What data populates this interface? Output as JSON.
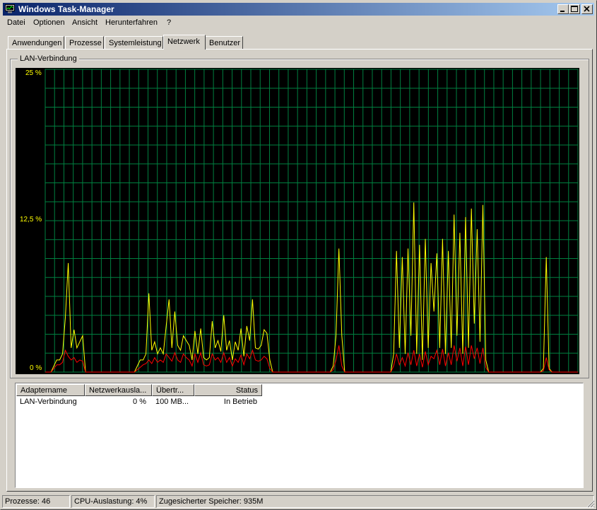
{
  "window": {
    "title": "Windows Task-Manager"
  },
  "menu": [
    "Datei",
    "Optionen",
    "Ansicht",
    "Herunterfahren",
    "?"
  ],
  "tabs": [
    "Anwendungen",
    "Prozesse",
    "Systemleistung",
    "Netzwerk",
    "Benutzer"
  ],
  "active_tab": "Netzwerk",
  "group": {
    "label": "LAN-Verbindung"
  },
  "graph": {
    "y_labels": [
      "25 %",
      "12,5 %",
      "0 %"
    ],
    "colors": {
      "background": "#000000",
      "grid": "#008040",
      "line_total": "#ffff00",
      "line_sent": "#ff0000"
    }
  },
  "chart_data": {
    "type": "line",
    "title": "LAN-Verbindung",
    "ylim": [
      0,
      25
    ],
    "y_tick_labels": [
      "25 %",
      "12,5 %",
      "0 %"
    ],
    "grid": true,
    "series": [
      {
        "color": "#ffff00",
        "values": [
          0,
          0,
          0,
          0.5,
          1,
          1,
          1.5,
          4.5,
          9,
          2,
          3.5,
          2,
          2.5,
          3,
          0,
          0,
          0,
          0,
          0,
          0,
          0,
          0,
          0,
          0,
          0,
          0,
          0,
          0,
          0,
          0,
          0,
          0,
          0.5,
          1,
          1,
          1.5,
          6.5,
          1.8,
          2.5,
          1.5,
          2,
          1.5,
          3.8,
          6,
          2,
          5,
          2.2,
          1.8,
          3,
          2.6,
          2.2,
          1,
          3.4,
          1.5,
          3.6,
          1.2,
          1,
          1.2,
          4.2,
          2,
          2.6,
          1.7,
          4.7,
          1.8,
          2.6,
          1,
          2.5,
          1.8,
          3.6,
          1.3,
          3.8,
          2.6,
          6,
          2,
          1.9,
          2.2,
          3.5,
          3.2,
          1,
          0,
          0,
          0,
          0,
          0,
          0,
          0,
          0,
          0,
          0,
          0,
          0,
          0,
          0,
          0,
          0,
          0,
          0,
          0,
          0,
          0,
          0.5,
          3,
          10.2,
          3,
          0,
          0,
          0,
          0,
          0,
          0,
          0,
          0,
          0,
          0,
          0,
          0,
          0,
          0,
          0,
          0,
          0,
          1.5,
          10,
          2,
          9.5,
          1.5,
          10.2,
          3,
          14,
          1.5,
          10.5,
          1,
          11,
          2,
          9,
          5,
          9.8,
          2,
          11,
          1.5,
          10,
          2,
          13,
          3,
          11.5,
          1.5,
          12.8,
          2,
          13.5,
          4,
          11.8,
          2.5,
          13.8,
          1,
          0,
          0,
          0,
          0,
          0,
          0,
          0,
          0,
          0,
          0,
          0,
          0,
          0,
          0,
          0,
          0,
          0,
          0,
          0,
          0.3,
          9.5,
          0.3,
          0,
          0,
          0,
          0,
          0,
          0,
          0,
          0,
          0,
          0
        ]
      },
      {
        "color": "#ff0000",
        "values": [
          0,
          0,
          0,
          0.3,
          0.6,
          0.6,
          0.8,
          1.8,
          1.3,
          1,
          1.2,
          0.8,
          1,
          0.9,
          0,
          0,
          0,
          0,
          0,
          0,
          0,
          0,
          0,
          0,
          0,
          0,
          0,
          0,
          0,
          0,
          0,
          0,
          0.2,
          0.4,
          0.6,
          0.7,
          1,
          0.7,
          1.2,
          0.8,
          1,
          0.8,
          1.5,
          1.2,
          0.9,
          1.6,
          1,
          0.8,
          1.5,
          1.2,
          1,
          0.5,
          1.5,
          0.8,
          1.6,
          0.6,
          0.5,
          0.6,
          1.5,
          1,
          1.2,
          0.8,
          1.6,
          0.8,
          1.2,
          0.5,
          1.1,
          0.8,
          1.4,
          0.6,
          1.5,
          1.1,
          1.8,
          1,
          0.9,
          1,
          1.3,
          1.1,
          0.3,
          0,
          0,
          0,
          0,
          0,
          0,
          0,
          0,
          0,
          0,
          0,
          0,
          0,
          0,
          0,
          0,
          0,
          0,
          0,
          0,
          0,
          0.2,
          1,
          2.2,
          0.5,
          0,
          0,
          0,
          0,
          0,
          0,
          0,
          0,
          0,
          0,
          0,
          0,
          0,
          0,
          0,
          0,
          0,
          0.5,
          1.5,
          0.6,
          1.2,
          0.5,
          1.6,
          0.6,
          1.8,
          0.5,
          1.5,
          0.4,
          1.7,
          0.6,
          1.3,
          1.1,
          1.8,
          0.6,
          1.9,
          0.5,
          1.6,
          0.6,
          2.2,
          0.9,
          2,
          0.5,
          2.1,
          0.6,
          2.2,
          1.1,
          2,
          0.7,
          2,
          0.4,
          0,
          0,
          0,
          0,
          0,
          0,
          0,
          0,
          0,
          0,
          0,
          0,
          0,
          0,
          0,
          0,
          0,
          0,
          0,
          0.1,
          1.2,
          0.2,
          0,
          0,
          0,
          0,
          0,
          0,
          0,
          0,
          0,
          0
        ]
      }
    ]
  },
  "adapter_list": {
    "columns": [
      "Adaptername",
      "Netzwerkausla...",
      "Übertr...",
      "Status"
    ],
    "rows": [
      {
        "name": "LAN-Verbindung",
        "usage": "0 %",
        "speed": "100 MB...",
        "status": "In Betrieb"
      }
    ]
  },
  "statusbar": {
    "processes": "Prozesse: 46",
    "cpu": "CPU-Auslastung: 4%",
    "memory": "Zugesicherter Speicher: 935M"
  }
}
